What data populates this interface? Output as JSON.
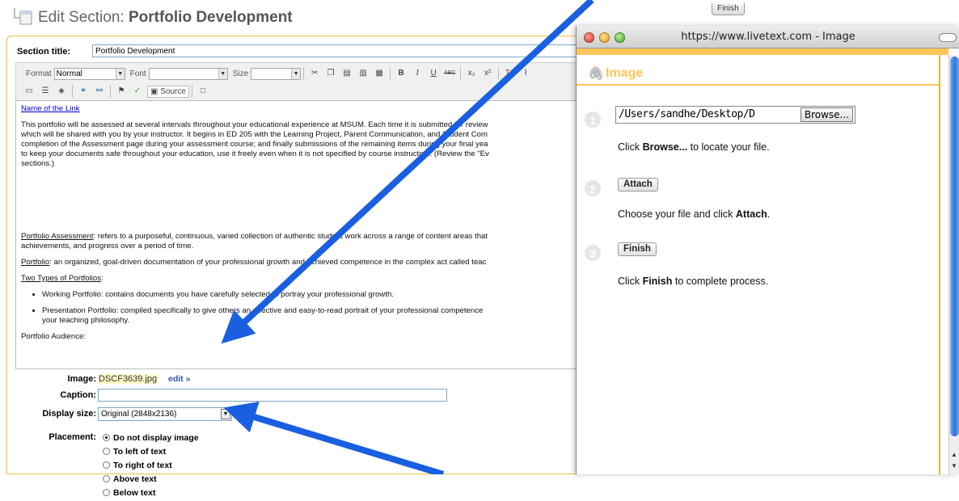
{
  "header": {
    "title_prefix": "Edit Section:",
    "title_name": "Portfolio Development",
    "finish_label": "Finish"
  },
  "section": {
    "title_label": "Section title:",
    "title_value": "Portfolio Development"
  },
  "toolbar": {
    "format_label": "Format",
    "format_value": "Normal",
    "font_label": "Font",
    "font_value": "",
    "size_label": "Size",
    "size_value": "",
    "source_label": "Source",
    "abc_label": "ABC"
  },
  "editor": {
    "link_text": "Name of the Link",
    "para1_line1": "This portfolio will be assessed at several intervals throughout your educational experience at MSUM.  Each time it is submitted for review",
    "para1_line2": "which will be shared with you by your instructor.  It begins in ED 205 with the Learning Project, Parent Communication, and Student Com",
    "para1_line3": "completion of the Assessment page during your assessment course; and finally submissions of the remaining items during your final yea",
    "para1_line4": "to keep your documents safe throughout your education, use it freely even when it is not specified by course instructors.  (Review the \"Ev",
    "para1_line5": "sections.)",
    "assess_term": "Portfolio Assessment",
    "assess_line1": ": refers to a purposeful, continuous, varied collection of authentic student work across a range of content areas that",
    "assess_line2": "achievements, and progress over a period of time.",
    "portfolio_term": "Portfolio",
    "portfolio_def": ": an organized, goal-driven documentation of your professional growth and achieved competence in the complex act called teac",
    "types_heading": "Two Types of Portfolios",
    "types_colon": ":",
    "bullet1": "Working Portfolio: contains documents you have carefully selected to portray your professional growth.",
    "bullet2_line1": "Presentation Portfolio: compiled specifically to give others an effective and easy-to-read portrait of your professional competence",
    "bullet2_line2": "your teaching philosophy.",
    "audience_heading": "Portfolio Audience:"
  },
  "image_props": {
    "image_label": "Image:",
    "file_name": "DSCF3639.jpg",
    "edit_link": "edit »",
    "caption_label": "Caption:",
    "caption_value": "",
    "display_size_label": "Display size:",
    "display_size_value": "Original (2848x2136)",
    "placement_label": "Placement:",
    "placement_options": [
      {
        "label": "Do not display image",
        "selected": true
      },
      {
        "label": "To left of text",
        "selected": false
      },
      {
        "label": "To right of text",
        "selected": false
      },
      {
        "label": "Above text",
        "selected": false
      },
      {
        "label": "Below text",
        "selected": false
      }
    ]
  },
  "popup": {
    "window_title": "https://www.livetext.com - Image",
    "heading": "Image",
    "steps": [
      {
        "num": "1",
        "instruction_pre": "Click ",
        "instruction_bold": "Browse...",
        "instruction_post": " to locate your file."
      },
      {
        "num": "2",
        "button": "Attach",
        "instruction_pre": "Choose your file and click ",
        "instruction_bold": "Attach",
        "instruction_post": "."
      },
      {
        "num": "3",
        "button": "Finish",
        "instruction_pre": "Click ",
        "instruction_bold": "Finish",
        "instruction_post": " to complete process."
      }
    ],
    "file_path": "/Users/sandhe/Desktop/D",
    "browse_label": "Browse..."
  },
  "colors": {
    "accent_orange": "#fbc55a",
    "arrow_blue": "#1a5fe0",
    "link_blue": "#0000cc"
  }
}
